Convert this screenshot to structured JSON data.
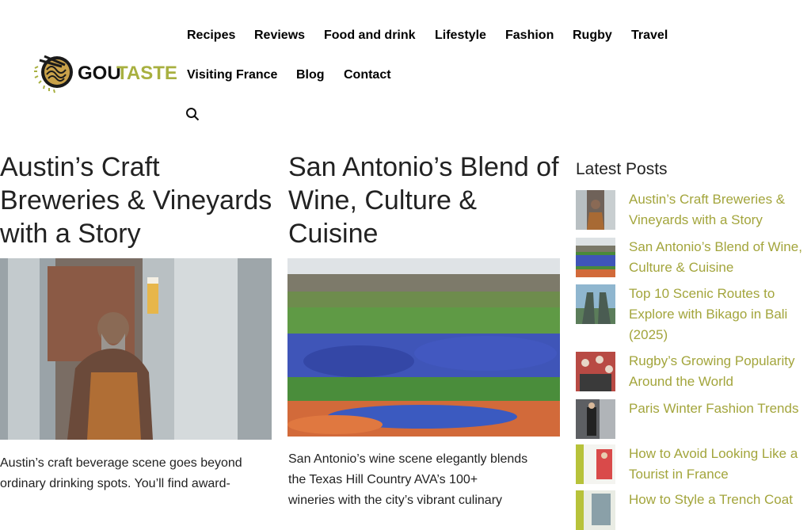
{
  "brand": {
    "logo_text_dark": "GOU",
    "logo_text_accent": "TASTE",
    "accent_color": "#a8b040"
  },
  "nav": {
    "items": [
      "Recipes",
      "Reviews",
      "Food and drink",
      "Lifestyle",
      "Fashion",
      "Rugby",
      "Travel",
      "Visiting France",
      "Blog",
      "Contact"
    ],
    "search_icon": "search-icon"
  },
  "posts": [
    {
      "title": "Austin’s Craft Breweries & Vineyards with a Story",
      "title_lines": [
        "Austin’s Craft",
        "Breweries & Vineyards",
        "with a Story"
      ],
      "excerpt_lines": [
        "Austin’s craft beverage scene goes beyond",
        "ordinary drinking spots. You’ll find award-"
      ]
    },
    {
      "title": "San Antonio’s Blend of Wine, Culture & Cuisine",
      "title_lines": [
        "San Antonio’s Blend of",
        "Wine, Culture &",
        "Cuisine"
      ],
      "excerpt_lines": [
        "San Antonio’s wine scene elegantly blends",
        "the Texas Hill Country AVA’s 100+",
        "wineries with the city’s vibrant culinary"
      ]
    }
  ],
  "sidebar": {
    "title": "Latest Posts",
    "link_color": "#a3a53c",
    "items": [
      {
        "lines": [
          "Austin’s Craft Breweries &",
          "Vineyards with a Story"
        ]
      },
      {
        "lines": [
          "San Antonio’s Blend of Wine,",
          "Culture & Cuisine"
        ]
      },
      {
        "lines": [
          "Top 10 Scenic Routes to",
          "Explore with Bikago in Bali",
          "(2025)"
        ]
      },
      {
        "lines": [
          "Rugby’s Growing Popularity",
          "Around the World"
        ]
      },
      {
        "lines": [
          "Paris Winter Fashion Trends"
        ]
      },
      {
        "lines": [
          "How to Avoid Looking Like a",
          "Tourist in France"
        ]
      },
      {
        "lines": [
          "How to Style a Trench Coat"
        ]
      }
    ]
  }
}
